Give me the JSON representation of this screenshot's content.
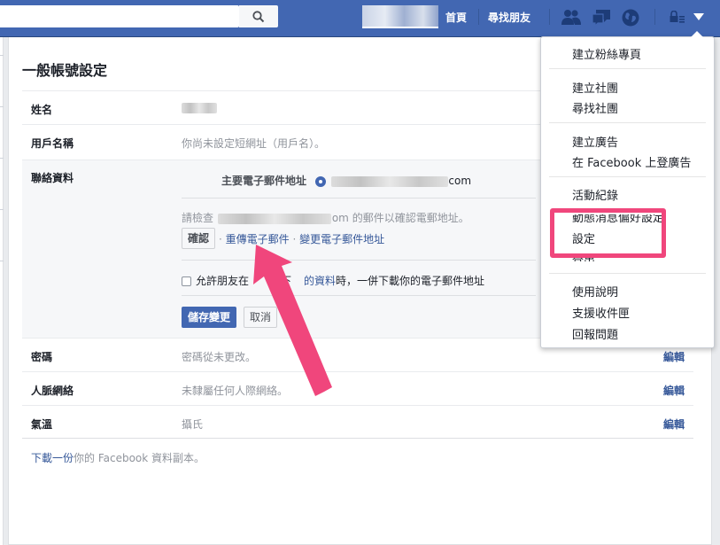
{
  "topbar": {
    "nav_home": "首頁",
    "nav_find_friends": "尋找朋友",
    "icons": [
      "friend-requests-icon",
      "messages-icon",
      "notifications-globe-icon",
      "privacy-lock-icon",
      "account-menu-chevron-icon"
    ]
  },
  "settings": {
    "title": "一般帳號設定",
    "rows": {
      "name": {
        "label": "姓名"
      },
      "username": {
        "label": "用戶名稱",
        "value": "你尚未設定短網址（用戶名）。"
      },
      "contact": {
        "label": "聯絡資料",
        "primary_email_label": "主要電子郵件地址",
        "email_suffix": "com",
        "verify_prefix": "請檢查",
        "verify_suffix": "om 的郵件以確認電郵地址。",
        "confirm_button": "確認",
        "link_sep1": "·",
        "resend_link": "重傳電子郵件",
        "link_sep2": "·",
        "change_link": "變更電子郵件地址",
        "allow_text_a": "允許朋友在",
        "allow_text_b": "下",
        "allow_link": "的資料",
        "allow_text_c": "時，一併下載你的電子郵件地址",
        "save_button": "儲存變更",
        "cancel_button": "取消"
      },
      "password": {
        "label": "密碼",
        "value": "密碼從未更改。",
        "edit": "編輯"
      },
      "networks": {
        "label": "人脈網絡",
        "value": "未隸屬任何人際網絡。",
        "edit": "編輯"
      },
      "temperature": {
        "label": "氣溫",
        "value": "攝氏",
        "edit": "編輯"
      }
    },
    "download_link": "下載一份",
    "download_text": "你的 Facebook 資料副本。"
  },
  "dropdown": {
    "create_page": "建立粉絲專頁",
    "create_group": "建立社團",
    "find_groups": "尋找社團",
    "create_ads": "建立廣告",
    "advertise": "在 Facebook 上登廣告",
    "activity_log": "活動紀錄",
    "news_feed_prefs": "動態消息偏好設定",
    "settings": "設定",
    "log_out": "登出",
    "help": "使用說明",
    "support_inbox": "支援收件匣",
    "report_problem": "回報問題"
  },
  "colors": {
    "brand": "#4267b2",
    "highlight": "#f0467c"
  }
}
